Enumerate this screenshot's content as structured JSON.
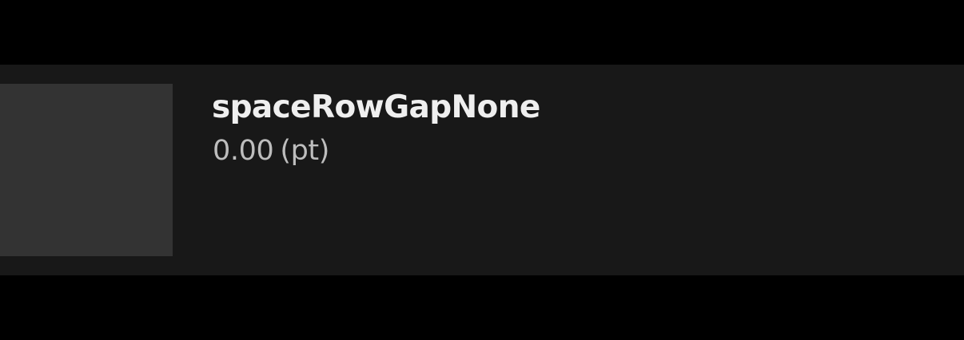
{
  "token": {
    "name": "spaceRowGapNone",
    "value": "0.00",
    "unit": "(pt)"
  },
  "colors": {
    "page_background": "#000000",
    "card_background": "#181818",
    "swatch_fill": "#333333",
    "name_text": "#efefef",
    "value_text": "#bdbdbd"
  }
}
